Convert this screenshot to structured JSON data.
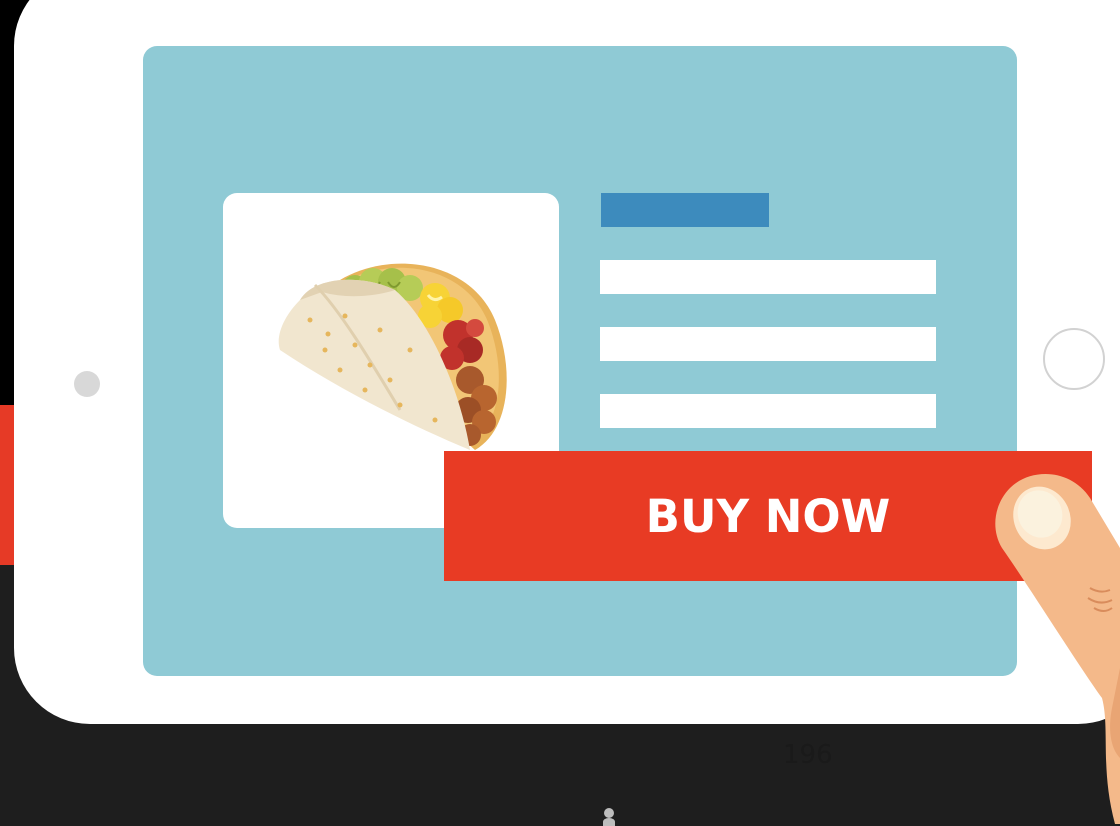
{
  "buy_button": {
    "label": "BUY NOW"
  },
  "page_number": "196",
  "colors": {
    "screen": "#8fcad5",
    "button": "#e83b24",
    "title_bar": "#3d8bbd",
    "tablet": "#ffffff",
    "background": "#1e1e1e"
  },
  "icons": {
    "product_image": "taco-icon",
    "pointer": "pointing-finger-icon",
    "home_button": "circle-icon"
  }
}
